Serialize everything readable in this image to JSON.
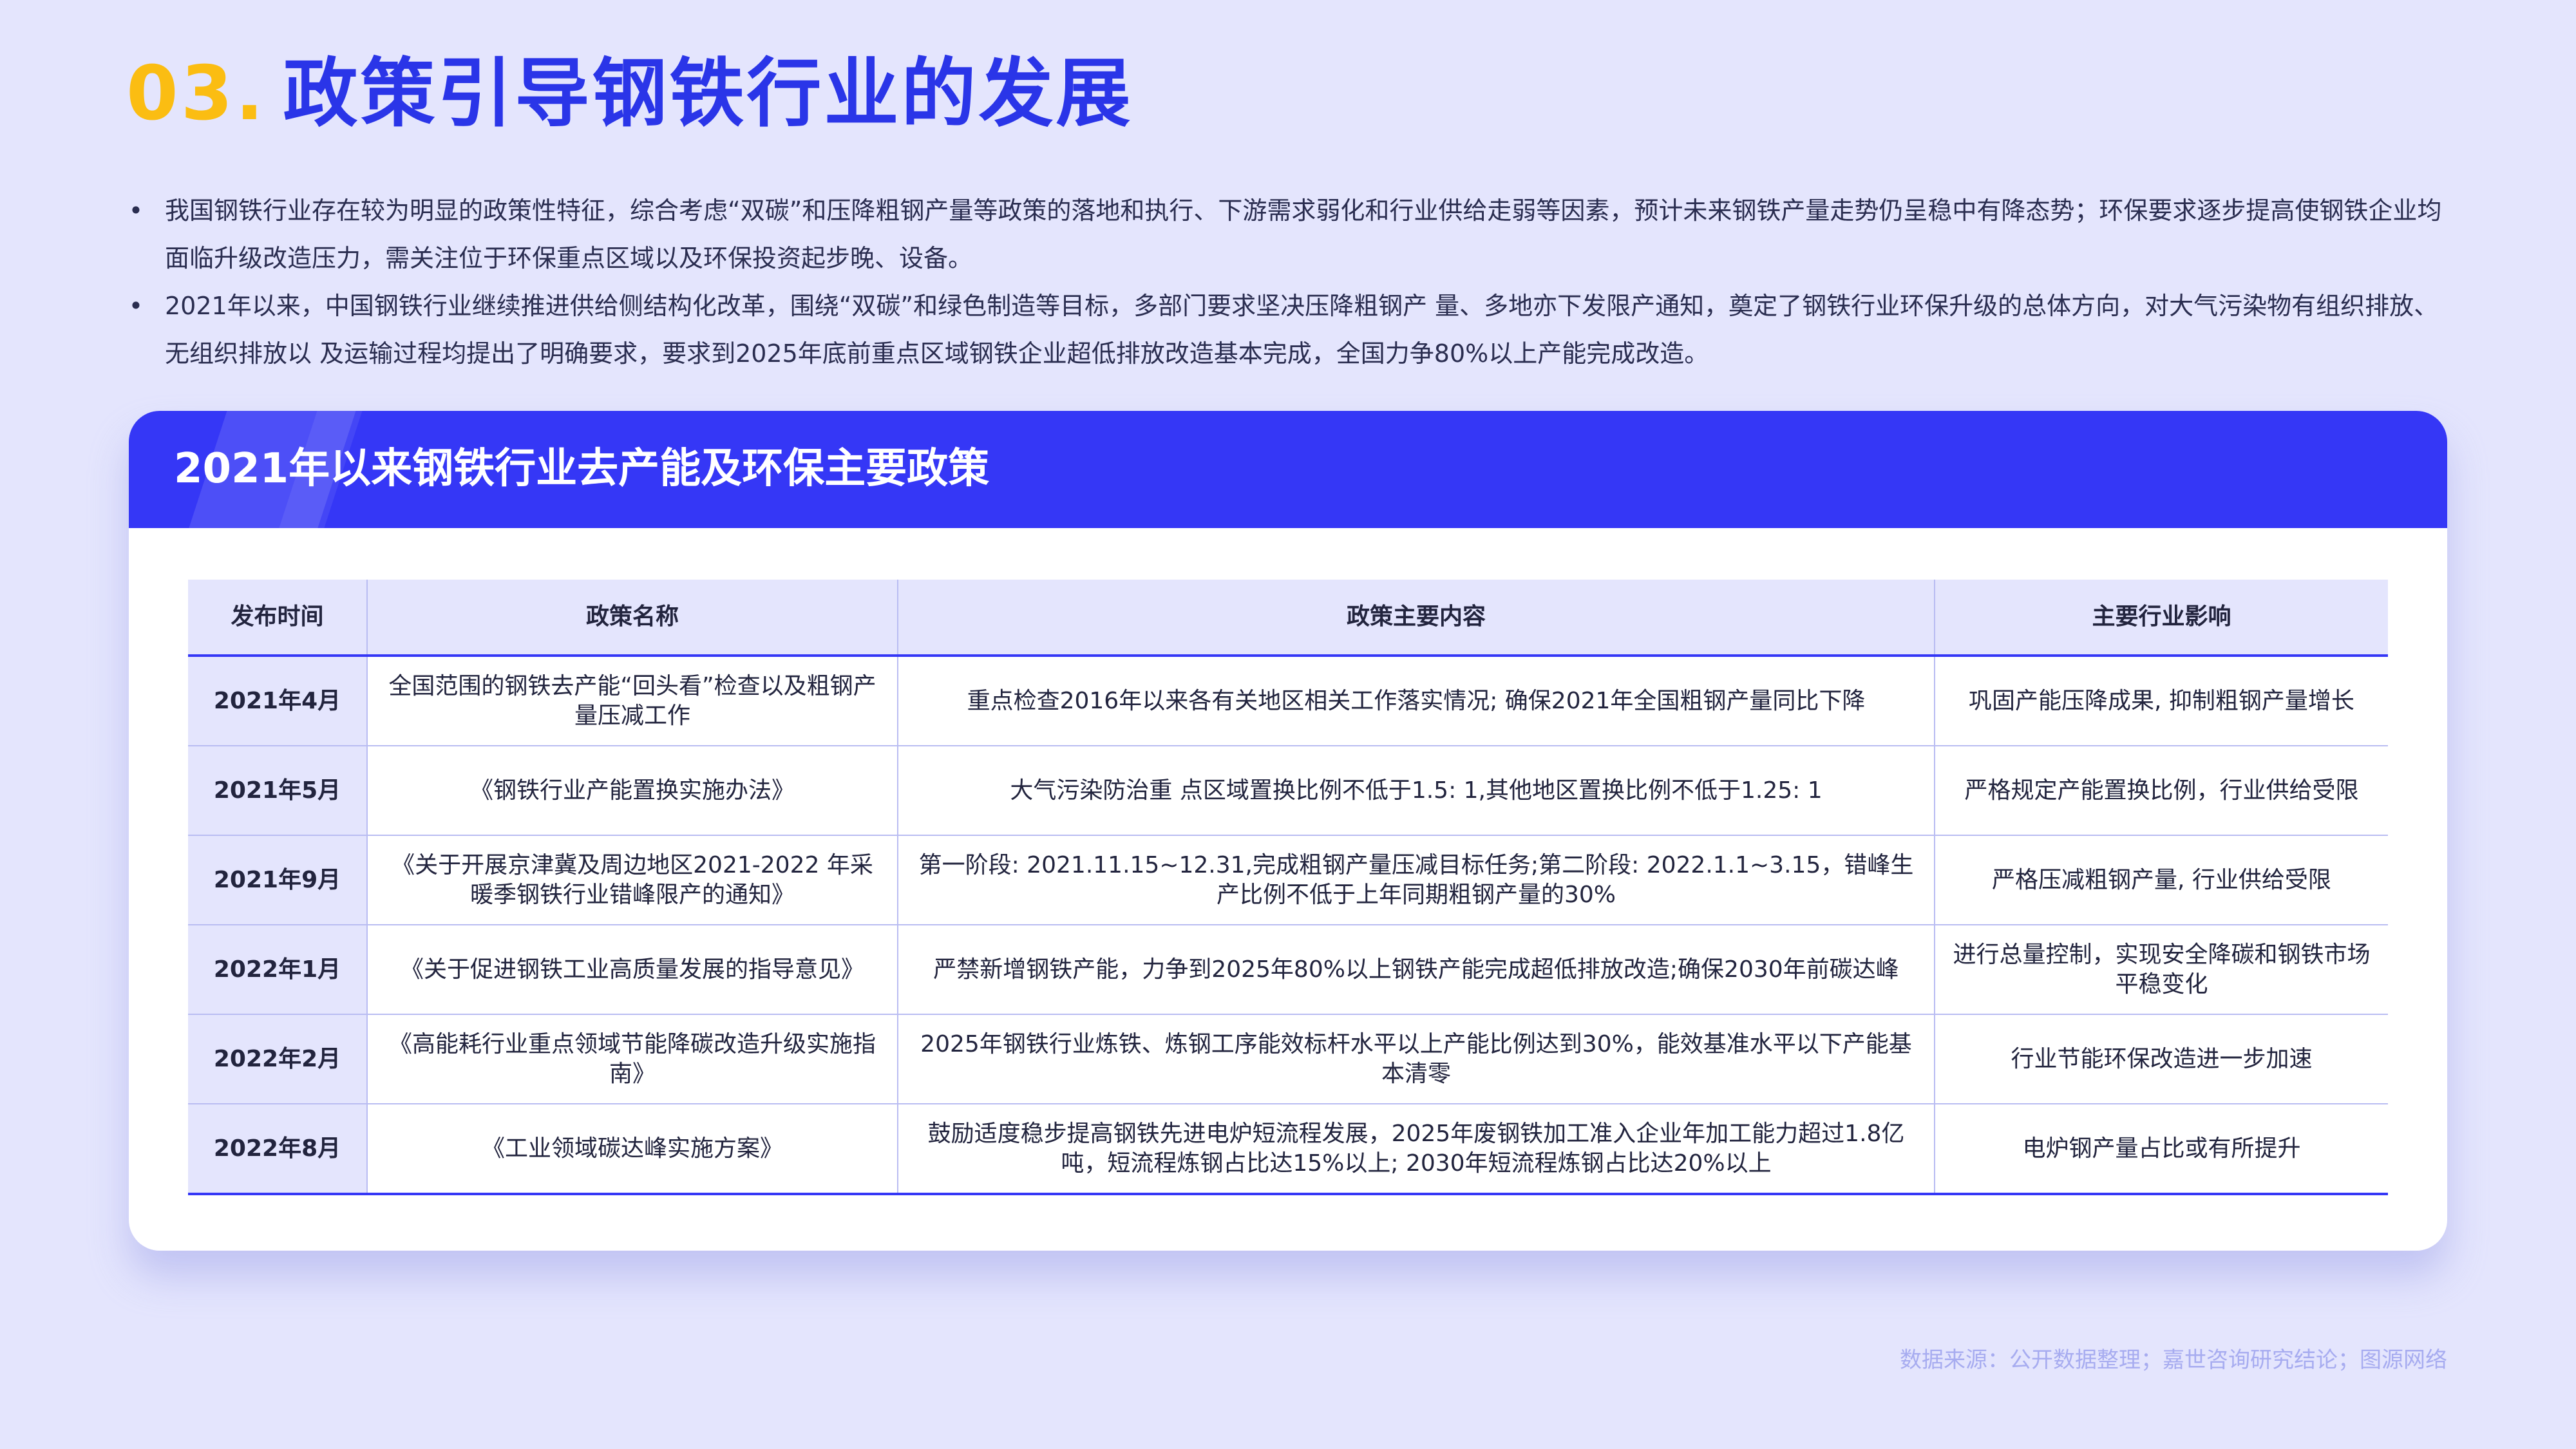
{
  "header": {
    "number": "03.",
    "title": "政策引导钢铁行业的发展"
  },
  "bullets": [
    "我国钢铁行业存在较为明显的政策性特征，综合考虑“双碳”和压降粗钢产量等政策的落地和执行、下游需求弱化和行业供给走弱等因素，预计未来钢铁产量走势仍呈稳中有降态势；环保要求逐步提高使钢铁企业均面临升级改造压力，需关注位于环保重点区域以及环保投资起步晚、设备。",
    "2021年以来，中国钢铁行业继续推进供给侧结构化改革，围绕“双碳”和绿色制造等目标，多部门要求坚决压降粗钢产  量、多地亦下发限产通知，奠定了钢铁行业环保升级的总体方向，对大气污染物有组织排放、无组织排放以 及运输过程均提出了明确要求，要求到2025年底前重点区域钢铁企业超低排放改造基本完成，全国力争80%以上产能完成改造。"
  ],
  "card": {
    "title": "2021年以来钢铁行业去产能及环保主要政策"
  },
  "table": {
    "headers": [
      "发布时间",
      "政策名称",
      "政策主要内容",
      "主要行业影响"
    ],
    "rows": [
      {
        "date": "2021年4月",
        "name": "全国范围的钢铁去产能“回头看”检查以及粗钢产量压减工作",
        "content": "重点检查2016年以来各有关地区相关工作落实情况; 确保2021年全国粗钢产量同比下降",
        "impact": "巩固产能压降成果, 抑制粗钢产量增长"
      },
      {
        "date": "2021年5月",
        "name": "《钢铁行业产能置换实施办法》",
        "content": "大气污染防治重 点区域置换比例不低于1.5: 1,其他地区置换比例不低于1.25: 1",
        "impact": "严格规定产能置换比例，行业供给受限"
      },
      {
        "date": "2021年9月",
        "name": "《关于开展京津冀及周边地区2021-2022 年采暖季钢铁行业错峰限产的通知》",
        "content": "第一阶段: 2021.11.15~12.31,完成粗钢产量压减目标任务;第二阶段: 2022.1.1~3.15，错峰生产比例不低于上年同期粗钢产量的30%",
        "impact": "严格压减粗钢产量, 行业供给受限"
      },
      {
        "date": "2022年1月",
        "name": "《关于促进钢铁工业高质量发展的指导意见》",
        "content": "严禁新增钢铁产能，力争到2025年80%以上钢铁产能完成超低排放改造;确保2030年前碳达峰",
        "impact": "进行总量控制，实现安全降碳和钢铁市场平稳变化"
      },
      {
        "date": "2022年2月",
        "name": "《高能耗行业重点领域节能降碳改造升级实施指南》",
        "content": "2025年钢铁行业炼铁、炼钢工序能效标杆水平以上产能比例达到30%，能效基准水平以下产能基本清零",
        "impact": "行业节能环保改造进一步加速"
      },
      {
        "date": "2022年8月",
        "name": "《工业领域碳达峰实施方案》",
        "content": "鼓励适度稳步提高钢铁先进电炉短流程发展，2025年废钢铁加工准入企业年加工能力超过1.8亿吨，短流程炼钢占比达15%以上; 2030年短流程炼钢占比达20%以上",
        "impact": "电炉钢产量占比或有所提升"
      }
    ]
  },
  "source": "数据来源：公开数据整理；嘉世咨询研究结论；图源网络",
  "colors": {
    "background": "#e4e5fd",
    "accent_blue": "#3537f6",
    "title_blue": "#2a35e8",
    "number_yellow": "#fbbd12"
  }
}
